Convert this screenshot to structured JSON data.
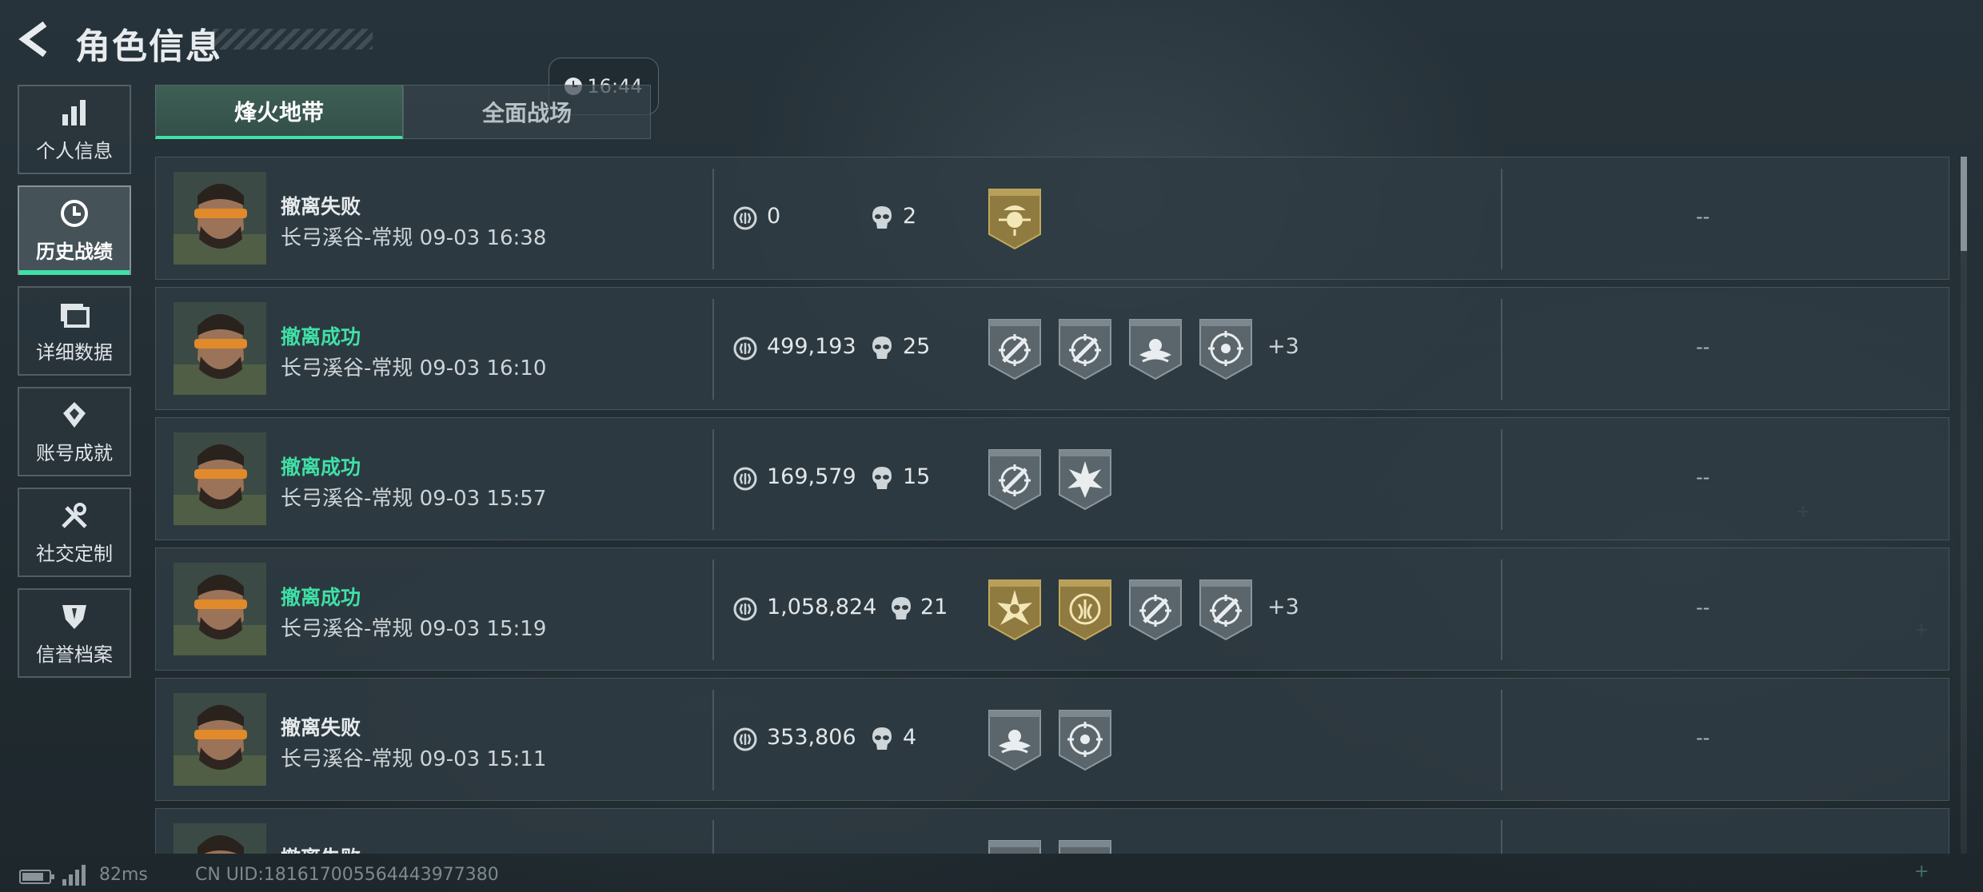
{
  "header": {
    "title": "角色信息",
    "back_icon": "back-arrow-icon"
  },
  "clock": {
    "time": "16:44",
    "icon": "clock-icon"
  },
  "sidebar": {
    "items": [
      {
        "label": "个人信息",
        "icon": "bar-chart-icon",
        "active": false
      },
      {
        "label": "历史战绩",
        "icon": "history-clock-icon",
        "active": true
      },
      {
        "label": "详细数据",
        "icon": "folder-icon",
        "active": false
      },
      {
        "label": "账号成就",
        "icon": "achievement-icon",
        "active": false
      },
      {
        "label": "社交定制",
        "icon": "tools-icon",
        "active": false
      },
      {
        "label": "信誉档案",
        "icon": "shield-icon",
        "active": false
      }
    ]
  },
  "tabs": [
    {
      "label": "烽火地带",
      "active": true
    },
    {
      "label": "全面战场",
      "active": false
    }
  ],
  "records": [
    {
      "status": "撤离失败",
      "success": false,
      "detail": "长弓溪谷-常规 09-03 16:38",
      "coins": "0",
      "kills": "2",
      "badges": [
        "gold-commander-badge"
      ],
      "more": "",
      "extra": "--"
    },
    {
      "status": "撤离成功",
      "success": true,
      "detail": "长弓溪谷-常规 09-03 16:10",
      "coins": "499,193",
      "kills": "25",
      "badges": [
        "rifle-target-badge",
        "rifle-target-badge",
        "wave-badge",
        "eagle-target-badge"
      ],
      "more": "+3",
      "extra": "--"
    },
    {
      "status": "撤离成功",
      "success": true,
      "detail": "长弓溪谷-常规 09-03 15:57",
      "coins": "169,579",
      "kills": "15",
      "badges": [
        "rifle-target-badge",
        "explosion-badge"
      ],
      "more": "",
      "extra": "--"
    },
    {
      "status": "撤离成功",
      "success": true,
      "detail": "长弓溪谷-常规 09-03 15:19",
      "coins": "1,058,824",
      "kills": "21",
      "badges": [
        "gold-star-badge",
        "gold-laurel-badge",
        "rifle-target-badge",
        "rifle-target-badge"
      ],
      "more": "+3",
      "extra": "--"
    },
    {
      "status": "撤离失败",
      "success": false,
      "detail": "长弓溪谷-常规 09-03 15:11",
      "coins": "353,806",
      "kills": "4",
      "badges": [
        "wave-badge",
        "crosshair-badge"
      ],
      "more": "",
      "extra": "--"
    },
    {
      "status": "撤离失败",
      "success": false,
      "detail": "",
      "coins": "",
      "kills": "",
      "badges": [
        "rifle-target-badge",
        "rifle-target-badge"
      ],
      "more": "",
      "extra": ""
    }
  ],
  "footer": {
    "ping": "82ms",
    "uid": "CN UID:181617005564443977380",
    "battery_level": 0.8
  },
  "colors": {
    "accent": "#3fe0a6",
    "row_bg": "#303c43",
    "gold_badge": "#a08a4a",
    "gray_badge": "#5d686d"
  }
}
